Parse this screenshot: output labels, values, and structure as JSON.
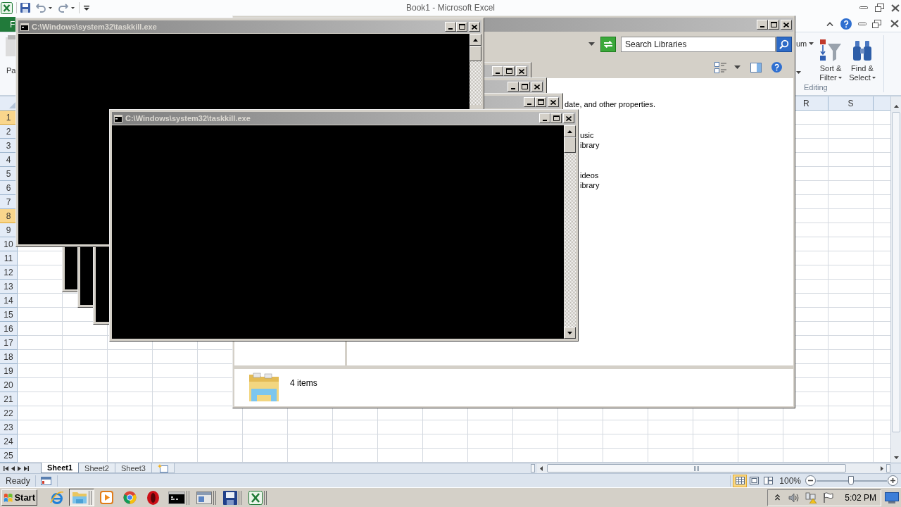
{
  "excel": {
    "title": "Book1 - Microsoft Excel",
    "file_tab": "F",
    "ribbon": {
      "paste_label": "Pa",
      "autosum_label": "um",
      "buttons": [
        {
          "kind": "sort",
          "lines": [
            "Sort &",
            "Filter"
          ]
        },
        {
          "kind": "find",
          "lines": [
            "Find &",
            "Select"
          ]
        }
      ],
      "group_label": "Editing"
    },
    "column_headers": [
      "R",
      "S"
    ],
    "rows": [
      {
        "label": "1",
        "selected": true
      },
      {
        "label": "2",
        "selected": false
      },
      {
        "label": "3",
        "selected": false
      },
      {
        "label": "4",
        "selected": false
      },
      {
        "label": "5",
        "selected": false
      },
      {
        "label": "6",
        "selected": false
      },
      {
        "label": "7",
        "selected": false
      },
      {
        "label": "8",
        "selected": true
      },
      {
        "label": "9",
        "selected": false
      },
      {
        "label": "10",
        "selected": false
      },
      {
        "label": "11",
        "selected": false
      },
      {
        "label": "12",
        "selected": false
      },
      {
        "label": "13",
        "selected": false
      },
      {
        "label": "14",
        "selected": false
      },
      {
        "label": "15",
        "selected": false
      },
      {
        "label": "16",
        "selected": false
      },
      {
        "label": "17",
        "selected": false
      },
      {
        "label": "18",
        "selected": false
      },
      {
        "label": "19",
        "selected": false
      },
      {
        "label": "20",
        "selected": false
      },
      {
        "label": "21",
        "selected": false
      },
      {
        "label": "22",
        "selected": false
      },
      {
        "label": "23",
        "selected": false
      },
      {
        "label": "24",
        "selected": false
      },
      {
        "label": "25",
        "selected": false
      }
    ],
    "sheet_tabs": [
      {
        "label": "Sheet1",
        "selected": true
      },
      {
        "label": "Sheet2",
        "selected": false
      },
      {
        "label": "Sheet3",
        "selected": false
      }
    ],
    "status_bar": {
      "status": "Ready",
      "view_buttons": [
        {
          "kind": "normal",
          "selected": true
        },
        {
          "kind": "page_layout",
          "selected": false
        },
        {
          "kind": "page_break",
          "selected": false
        }
      ],
      "zoom": "100%",
      "zoom_slider": {
        "level": 0.49
      }
    }
  },
  "explorer": {
    "search": {
      "placeholder": "Search Libraries"
    },
    "description": "date, and other properties.",
    "libraries": [
      {
        "name": "usic",
        "type": "ibrary"
      },
      {
        "name": "ideos",
        "type": "ibrary"
      }
    ],
    "details": "4 items"
  },
  "console_windows": [
    {
      "kind": "console",
      "title": "C:\\Windows\\system32\\taskkill.exe",
      "scrollbar": true
    },
    {
      "kind": "console"
    },
    {
      "kind": "console"
    },
    {
      "kind": "console"
    },
    {
      "kind": "console",
      "title": "C:\\Windows\\system32\\taskkill.exe",
      "scrollbar": true
    }
  ],
  "taskbar": {
    "start": "Start",
    "apps": [
      {
        "kind": "ie",
        "selected": false,
        "grouped": false
      },
      {
        "kind": "explorer",
        "selected": true,
        "grouped": true
      },
      {
        "kind": "media",
        "selected": false,
        "grouped": false
      },
      {
        "kind": "chrome",
        "selected": false,
        "grouped": false
      },
      {
        "kind": "opera",
        "selected": false,
        "grouped": false
      },
      {
        "kind": "console",
        "selected": false,
        "grouped": true
      },
      {
        "kind": "window",
        "selected": false,
        "grouped": true
      },
      {
        "kind": "disk",
        "selected": false,
        "grouped": true
      },
      {
        "kind": "excel",
        "selected": false,
        "grouped": true
      }
    ],
    "clock": "5:02 PM"
  }
}
